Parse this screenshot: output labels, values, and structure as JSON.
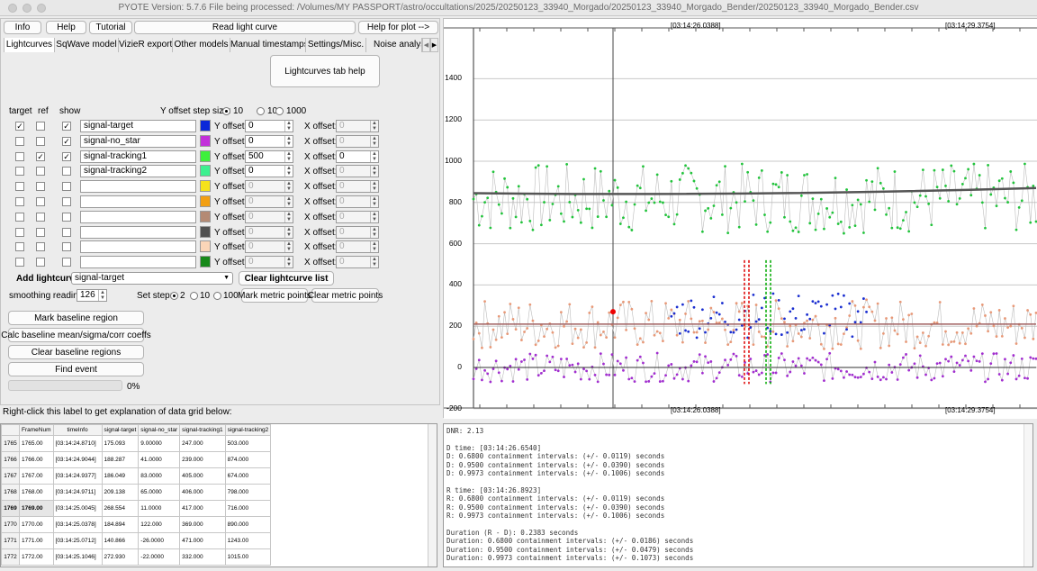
{
  "window": {
    "title": "PYOTE Version: 5.7.6  File being processed: /Volumes/MY PASSPORT/astro/occultations/2025/20250123_33940_Morgado/20250123_33940_Morgado_Bender/20250123_33940_Morgado_Bender.csv"
  },
  "top_buttons": {
    "info": "Info",
    "help": "Help",
    "tutorial": "Tutorial",
    "read": "Read light curve",
    "help_plot": "Help for plot -->"
  },
  "tabs": [
    "Lightcurves",
    "SqWave model",
    "VizieR export",
    "Other models",
    "Manual timestamps",
    "Settings/Misc.",
    "Noise analysis/"
  ],
  "tab_help": "Lightcurves tab help",
  "curves_header": {
    "target": "target",
    "ref": "ref",
    "show": "show",
    "step_label": "Y offset step size:",
    "steps": [
      "10",
      "100",
      "1000"
    ],
    "step_selected": "10"
  },
  "curve_rows": [
    {
      "name": "signal-target",
      "target": true,
      "ref": false,
      "show": true,
      "color": "#0b27d9",
      "yoff": "0",
      "xoff": "0",
      "yen": true,
      "xen": false
    },
    {
      "name": "signal-no_star",
      "target": false,
      "ref": false,
      "show": true,
      "color": "#c230da",
      "yoff": "0",
      "xoff": "0",
      "yen": true,
      "xen": false
    },
    {
      "name": "signal-tracking1",
      "target": false,
      "ref": true,
      "show": true,
      "color": "#3ef03c",
      "yoff": "500",
      "xoff": "0",
      "yen": true,
      "xen": true
    },
    {
      "name": "signal-tracking2",
      "target": false,
      "ref": false,
      "show": false,
      "color": "#3df08f",
      "yoff": "0",
      "xoff": "0",
      "yen": true,
      "xen": false
    },
    {
      "name": "",
      "target": false,
      "ref": false,
      "show": false,
      "color": "#f5e21b",
      "yoff": "0",
      "xoff": "0",
      "yen": false,
      "xen": false
    },
    {
      "name": "",
      "target": false,
      "ref": false,
      "show": false,
      "color": "#f29f12",
      "yoff": "0",
      "xoff": "0",
      "yen": false,
      "xen": false
    },
    {
      "name": "",
      "target": false,
      "ref": false,
      "show": false,
      "color": "#b48a74",
      "yoff": "0",
      "xoff": "0",
      "yen": false,
      "xen": false
    },
    {
      "name": "",
      "target": false,
      "ref": false,
      "show": false,
      "color": "#505050",
      "yoff": "0",
      "xoff": "0",
      "yen": false,
      "xen": false
    },
    {
      "name": "",
      "target": false,
      "ref": false,
      "show": false,
      "color": "#fbd6b8",
      "yoff": "0",
      "xoff": "0",
      "yen": false,
      "xen": false
    },
    {
      "name": "",
      "target": false,
      "ref": false,
      "show": false,
      "color": "#17891a",
      "yoff": "0",
      "xoff": "0",
      "yen": false,
      "xen": false
    }
  ],
  "labels": {
    "yoffset": "Y offset:",
    "xoffset": "X offset:",
    "add_lightcurve": "Add lightcurve",
    "add_value": "signal-target",
    "clear_list": "Clear lightcurve list",
    "smoothing": "smoothing readings",
    "smoothing_value": "126",
    "set_step": "Set step:",
    "set_step_options": [
      "2",
      "10",
      "100"
    ],
    "set_step_selected": "2",
    "mark_metric": "Mark metric points",
    "clear_metric": "Clear metric points",
    "mark_baseline": "Mark baseline region",
    "calc_baseline": "Calc baseline mean/sigma/corr coeffs",
    "clear_baseline": "Clear baseline regions",
    "find_event": "Find event",
    "progress_text": "0%",
    "grid_hint": "Right-click this label to get explanation of data grid below:"
  },
  "plot": {
    "top_left_time": "[03:14:26.0388]",
    "top_right_time": "[03:14:29.3754]",
    "bottom_left_time": "[03:14:26.0388]",
    "bottom_right_time": "[03:14:29.3754]",
    "yticks": [
      "1400",
      "1200",
      "1000",
      "800",
      "600",
      "400",
      "200",
      "0",
      "-200"
    ]
  },
  "grid": {
    "columns": [
      "FrameNum",
      "timeInfo",
      "signal-target",
      "signal-no_star",
      "signal-tracking1",
      "signal-tracking2"
    ],
    "rows": [
      [
        "1765",
        "1765.00",
        "[03:14:24.8710]",
        "175.093",
        "9.00000",
        "247.000",
        "503.000"
      ],
      [
        "1766",
        "1766.00",
        "[03:14:24.9044]",
        "188.287",
        "41.0000",
        "239.000",
        "874.000"
      ],
      [
        "1767",
        "1767.00",
        "[03:14:24.9377]",
        "186.049",
        "83.0000",
        "405.000",
        "674.000"
      ],
      [
        "1768",
        "1768.00",
        "[03:14:24.9711]",
        "209.138",
        "65.0000",
        "406.000",
        "798.000"
      ],
      [
        "1769",
        "1769.00",
        "[03:14:25.0045]",
        "268.554",
        "11.0000",
        "417.000",
        "716.000"
      ],
      [
        "1770",
        "1770.00",
        "[03:14:25.0378]",
        "184.894",
        "122.000",
        "369.000",
        "890.000"
      ],
      [
        "1771",
        "1771.00",
        "[03:14:25.0712]",
        "140.866",
        "-26.0000",
        "471.000",
        "1243.00"
      ],
      [
        "1772",
        "1772.00",
        "[03:14:25.1046]",
        "272.930",
        "-22.0000",
        "332.000",
        "1015.00"
      ]
    ]
  },
  "output_text": "DNR: 2.13\n\nD time: [03:14:26.6540]\nD: 0.6800 containment intervals: (+/- 0.0119) seconds\nD: 0.9500 containment intervals: (+/- 0.0390) seconds\nD: 0.9973 containment intervals: (+/- 0.1006) seconds\n\nR time: [03:14:26.8923]\nR: 0.6800 containment intervals: (+/- 0.0119) seconds\nR: 0.9500 containment intervals: (+/- 0.0390) seconds\nR: 0.9973 containment intervals: (+/- 0.1006) seconds\n\nDuration (R - D): 0.2383 seconds\nDuration: 0.6800 containment intervals: (+/- 0.0186) seconds\nDuration: 0.9500 containment intervals: (+/- 0.0479) seconds\nDuration: 0.9973 containment intervals: (+/- 0.1073) seconds"
}
